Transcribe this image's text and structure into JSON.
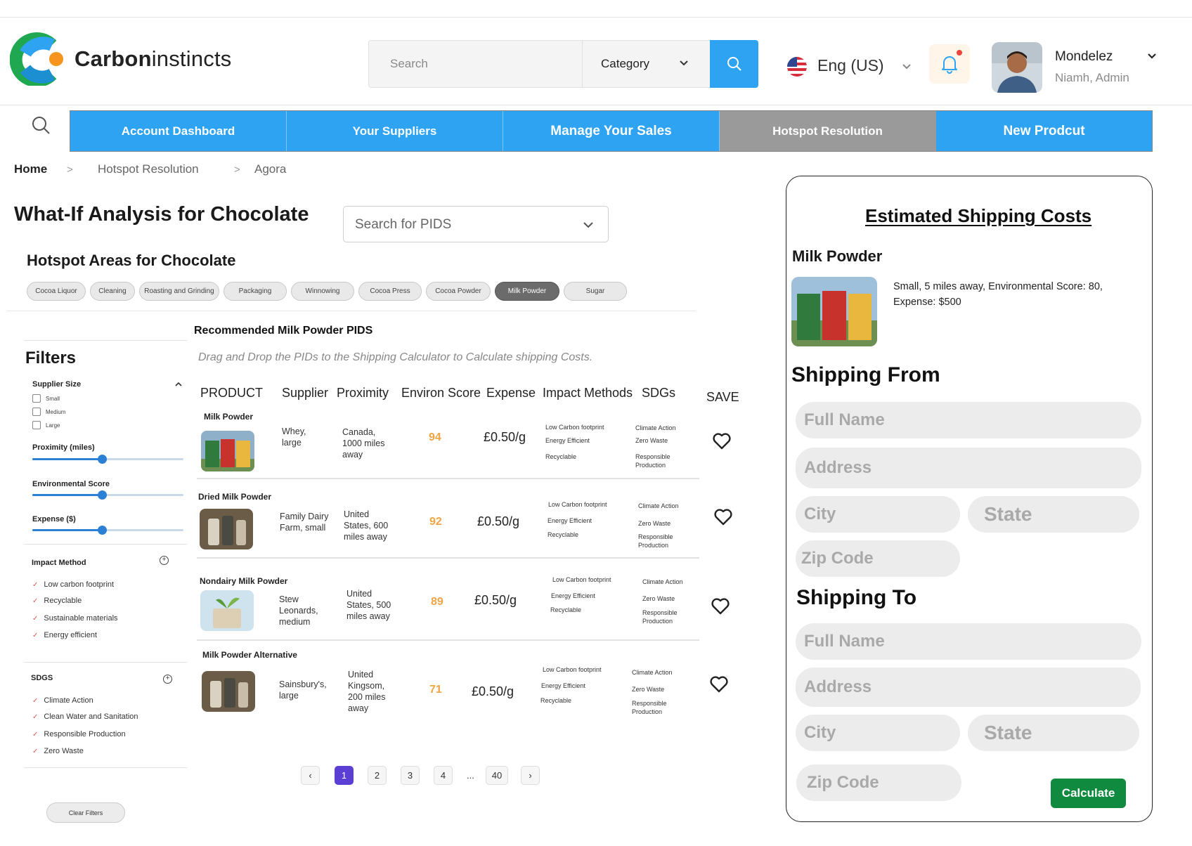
{
  "header": {
    "logo_text_bold": "Carbon",
    "logo_text_light": "instincts",
    "search_placeholder": "Search",
    "category_label": "Category",
    "language": "Eng (US)",
    "user_name": "Mondelez",
    "user_role": "Niamh, Admin"
  },
  "nav": {
    "tabs": [
      "Account Dashboard",
      "Your Suppliers",
      "Manage Your Sales",
      "Hotspot Resolution",
      "New Prodcut"
    ],
    "active_tab": "Hotspot Resolution"
  },
  "breadcrumb": [
    "Home",
    "Hotspot Resolution",
    "Agora"
  ],
  "page": {
    "title": "What-If Analysis for Chocolate",
    "pid_search_placeholder": "Search for PIDS",
    "hotspot_title": "Hotspot Areas for Chocolate",
    "hotspot_chips": [
      "Cocoa Liquor",
      "Cleaning",
      "Roasting and Grinding",
      "Packaging",
      "Winnowing",
      "Cocoa Press",
      "Cocoa Powder",
      "Milk Powder",
      "Sugar"
    ],
    "active_chip": "Milk Powder"
  },
  "filters": {
    "title": "Filters",
    "supplier_size_label": "Supplier Size",
    "supplier_sizes": [
      "Small",
      "Medium",
      "Large"
    ],
    "proximity_label": "Proximity (miles)",
    "proximity_level": 0.46,
    "env_score_label": "Environmental Score",
    "env_score_level": 0.46,
    "expense_label": "Expense ($)",
    "expense_level": 0.46,
    "impact_method_label": "Impact Method",
    "impact_methods": [
      "Low carbon footprint",
      "Recyclable",
      "Sustainable materials",
      "Energy efficient"
    ],
    "sdgs_label": "SDGS",
    "sdgs": [
      "Climate Action",
      "Clean Water and Sanitation",
      "Responsible Production",
      "Zero Waste"
    ],
    "clear_label": "Clear Filters"
  },
  "table": {
    "title": "Recommended Milk Powder PIDS",
    "note": "Drag and Drop the PIDs to the Shipping Calculator to Calculate shipping Costs.",
    "headers": [
      "PRODUCT",
      "Supplier",
      "Proximity",
      "Environ Score",
      "Expense",
      "Impact Methods",
      "SDGs",
      "SAVE"
    ],
    "rows": [
      {
        "product": "Milk Powder",
        "supplier": "Whey, large",
        "proximity": "Canada, 1000 miles away",
        "score": "94",
        "expense": "£0.50/g",
        "impact": [
          "Low Carbon footprint",
          "Energy Efficient",
          "Recyclable"
        ],
        "sdgs": [
          "Climate Action",
          "Zero Waste",
          "Responsible Production"
        ]
      },
      {
        "product": "Dried Milk Powder",
        "supplier": "Family Dairy Farm, small",
        "proximity": "United States, 600 miles away",
        "score": "92",
        "expense": "£0.50/g",
        "impact": [
          "Low Carbon footprint",
          "Energy Efficient",
          "Recyclable"
        ],
        "sdgs": [
          "Climate Action",
          "Zero Waste",
          "Responsible Production"
        ]
      },
      {
        "product": "Nondairy Milk Powder",
        "supplier": "Stew Leonards, medium",
        "proximity": "United States, 500 miles away",
        "score": "89",
        "expense": "£0.50/g",
        "impact": [
          "Low Carbon footprint",
          "Energy Efficient",
          "Recyclable"
        ],
        "sdgs": [
          "Climate Action",
          "Zero Waste",
          "Responsible Production"
        ]
      },
      {
        "product": "Milk Powder Alternative",
        "supplier": "Sainsbury's, large",
        "proximity": "United Kingsom, 200 miles away",
        "score": "71",
        "expense": "£0.50/g",
        "impact": [
          "Low Carbon footprint",
          "Energy Efficient",
          "Recyclable"
        ],
        "sdgs": [
          "Climate Action",
          "Zero Waste",
          "Responsible Production"
        ]
      }
    ]
  },
  "pagination": {
    "prev": "‹",
    "pages": [
      "1",
      "2",
      "3",
      "4"
    ],
    "ellipsis": "...",
    "last": "40",
    "next": "›",
    "current": "1"
  },
  "shipping": {
    "title": "Estimated Shipping Costs",
    "item_title": "Milk Powder",
    "item_desc": "Small, 5 miles away, Environmental Score: 80, Expense: $500",
    "from_title": "Shipping From",
    "to_title": "Shipping To",
    "full_name_placeholder": "Full Name",
    "address_placeholder": "Address",
    "city_placeholder": "City",
    "state_placeholder": "State",
    "zip_placeholder": "Zip Code",
    "calculate_label": "Calculate"
  },
  "colors": {
    "primary_blue": "#2ea3f2",
    "active_tab_gray": "#9a9a9a",
    "score_orange": "#f0a442",
    "calculate_green": "#108a3e",
    "pagination_purple": "#5b3fd4"
  }
}
